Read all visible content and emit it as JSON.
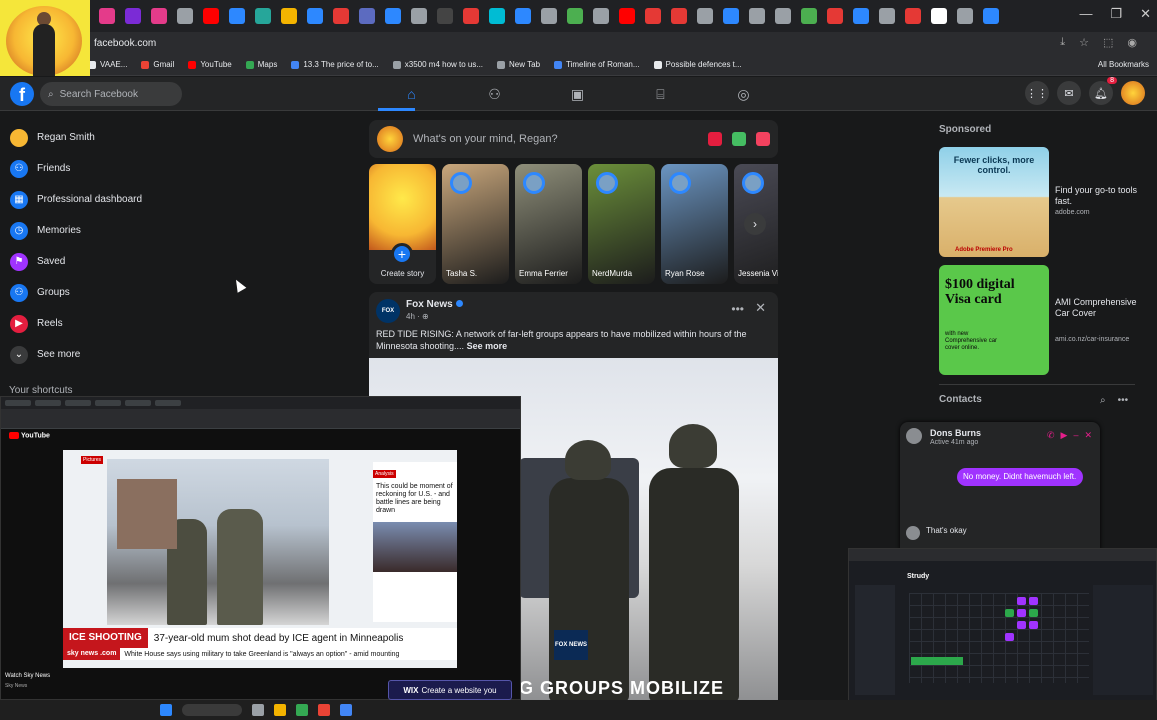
{
  "browser": {
    "url": "facebook.com",
    "window_controls": [
      "—",
      "❐",
      "✕"
    ],
    "bookmarks": [
      {
        "label": "VAAE...",
        "color": "#e8eaed"
      },
      {
        "label": "Gmail",
        "color": "#ea4335"
      },
      {
        "label": "YouTube",
        "color": "#ff0000"
      },
      {
        "label": "Maps",
        "color": "#34a853"
      },
      {
        "label": "13.3 The price of to...",
        "color": "#4285f4"
      },
      {
        "label": "x3500 m4 how to us...",
        "color": "#9aa0a6"
      },
      {
        "label": "New Tab",
        "color": "#9aa0a6"
      },
      {
        "label": "Timeline of Roman...",
        "color": "#4285f4"
      },
      {
        "label": "Possible defences t...",
        "color": "#e8eaed"
      }
    ],
    "all_bookmarks": "All Bookmarks",
    "tab_icon_colors": [
      "#e43b8a",
      "#7b2bd6",
      "#e43b8a",
      "#9aa0a6",
      "#ff0000",
      "#2d88ff",
      "#26a69a",
      "#f4b400",
      "#2d88ff",
      "#e53935",
      "#5c6bc0",
      "#2d88ff",
      "#9aa0a6",
      "#444",
      "#e53935",
      "#00bcd4",
      "#2d88ff",
      "#9aa0a6",
      "#4caf50",
      "#9aa0a6",
      "#ff0000",
      "#e53935",
      "#e53935",
      "#9aa0a6",
      "#2d88ff",
      "#9aa0a6",
      "#9aa0a6",
      "#4caf50",
      "#e53935",
      "#2d88ff",
      "#9aa0a6",
      "#e53935",
      "#ffffff",
      "#9aa0a6",
      "#2d88ff"
    ]
  },
  "facebook": {
    "logo": "f",
    "search_placeholder": "Search Facebook",
    "nav_icons": [
      "home-icon",
      "friends-icon",
      "marketplace-icon",
      "groups-icon",
      "gaming-icon"
    ],
    "notification_count": "8",
    "left_nav": [
      {
        "label": "Regan Smith",
        "icon": "avatar",
        "color": "#f7b733"
      },
      {
        "label": "Friends",
        "icon": "friends-icon",
        "color": "#1877f2"
      },
      {
        "label": "Professional dashboard",
        "icon": "dashboard-icon",
        "color": "#1877f2"
      },
      {
        "label": "Memories",
        "icon": "clock-icon",
        "color": "#1877f2"
      },
      {
        "label": "Saved",
        "icon": "bookmark-icon",
        "color": "#a033ff"
      },
      {
        "label": "Groups",
        "icon": "groups-icon",
        "color": "#1877f2"
      },
      {
        "label": "Reels",
        "icon": "reels-icon",
        "color": "#e41e3f"
      },
      {
        "label": "See more",
        "icon": "chevron-down-icon",
        "color": "#3a3b3c"
      }
    ],
    "shortcuts_label": "Your shortcuts",
    "composer_placeholder": "What's on your mind, Regan?",
    "stories": [
      {
        "name": "Create story",
        "bg": "create"
      },
      {
        "name": "Tasha S.",
        "bg": "#c9a77c"
      },
      {
        "name": "Emma Ferrier",
        "bg": "#8f8f7a"
      },
      {
        "name": "NerdMurda",
        "bg": "#6b8f3a"
      },
      {
        "name": "Ryan Rose",
        "bg": "#6b95c2"
      },
      {
        "name": "Jessenia Vi",
        "bg": "#4a4a55"
      }
    ],
    "post": {
      "page": "Fox News",
      "time": "4h · ",
      "text": "RED TIDE RISING: A network of far-left groups appears to have mobilized within hours of the Minnesota shooting....",
      "see_more": "See more",
      "image_badge": "FOX NEWS",
      "image_caption": "G GROUPS MOBILIZE"
    },
    "sponsored_label": "Sponsored",
    "ads": [
      {
        "headline": "Fewer clicks, more control.",
        "brand": "Adobe Premiere Pro",
        "title": "Find your go-to tools fast.",
        "url": "adobe.com"
      },
      {
        "headline": "$100 digital Visa card",
        "sub": "with new Comprehensive car cover online.",
        "title": "AMI Comprehensive Car Cover",
        "url": "ami.co.nz/car-insurance"
      }
    ],
    "contacts_label": "Contacts",
    "chat": {
      "name": "Dons Burns",
      "status": "Active 41m ago",
      "outgoing": "No money. Didnt havemuch left.",
      "incoming": "That's okay"
    }
  },
  "youtube_pip": {
    "tag": "Pictures",
    "side_tag": "Analysis",
    "side_text": "This could be moment of reckoning for U.S. - and battle lines are being drawn",
    "headline_tag": "ICE SHOOTING",
    "headline": "37-year-old mum shot dead by ICE agent in Minneapolis",
    "ticker_brand": "sky news .com",
    "ticker": "White House says using military to take Greenland is \"always an option\" - amid mounting",
    "channel": "Watch Sky News",
    "channel_sub": "Sky News"
  },
  "wix_ad": "Create a website you",
  "wix_logo": "WIX",
  "studio_pip": {
    "brand": "Strudy"
  },
  "chart_data": null
}
